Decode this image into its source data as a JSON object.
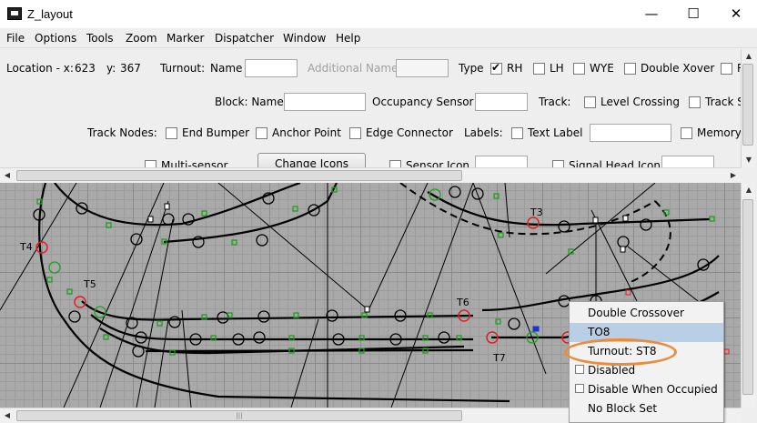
{
  "window": {
    "title": "Z_layout",
    "min_glyph": "—",
    "max_glyph": "☐",
    "close_glyph": "✕"
  },
  "menubar": [
    "File",
    "Options",
    "Tools",
    "Zoom",
    "Marker",
    "Dispatcher",
    "Window",
    "Help"
  ],
  "toolbar": {
    "location_label": "Location - x:",
    "location_x": "623",
    "location_y_label": "y:",
    "location_y": "367",
    "turnout_label": "Turnout:",
    "name_label": "Name",
    "name_value": "",
    "additional_name_label": "Additional Name",
    "additional_name_value": "",
    "type_label": "Type",
    "types": [
      {
        "label": "RH",
        "checked": true
      },
      {
        "label": "LH",
        "checked": false
      },
      {
        "label": "WYE",
        "checked": false
      },
      {
        "label": "Double Xover",
        "checked": false
      },
      {
        "label": "R",
        "checked": false
      }
    ],
    "block_name_label": "Block: Name",
    "block_name_value": "",
    "occupancy_sensor_label": "Occupancy Sensor",
    "occupancy_sensor_value": "",
    "track_label": "Track:",
    "level_crossing_label": "Level Crossing",
    "track_segment_label": "Track S",
    "track_nodes_label": "Track Nodes:",
    "end_bumper_label": "End Bumper",
    "anchor_point_label": "Anchor Point",
    "edge_connector_label": "Edge Connector",
    "labels_label": "Labels:",
    "text_label_label": "Text Label",
    "text_label_value": "",
    "memory_label": "Memory",
    "multi_sensor_label": "Multi-sensor",
    "change_icons_label": "Change Icons",
    "sensor_icon_label": "Sensor Icon",
    "signal_head_icon_label": "Signal Head Icon"
  },
  "canvas_labels": [
    "T3",
    "T4",
    "T5",
    "T6",
    "T7"
  ],
  "popup_menu": {
    "items": [
      {
        "label": "Double Crossover",
        "selected": false,
        "checkbox": false
      },
      {
        "label": "TO8",
        "selected": true,
        "checkbox": false
      },
      {
        "label": "Turnout: ST8",
        "selected": false,
        "checkbox": false
      },
      {
        "label": "Disabled",
        "selected": false,
        "checkbox": true
      },
      {
        "label": "Disable When Occupied",
        "selected": false,
        "checkbox": true
      },
      {
        "label": "No Block Set",
        "selected": false,
        "checkbox": false
      }
    ],
    "highlight_color": "#ed8b3a"
  },
  "scrollbar_glyphs": {
    "up": "▲",
    "down": "▼",
    "left": "◀",
    "right": "▶",
    "grip": "|||"
  },
  "colors": {
    "track": "#000000",
    "anchor": "#1ea01e",
    "turnout_circle": "#e02020",
    "canvas_bg": "#a9a9a9"
  }
}
